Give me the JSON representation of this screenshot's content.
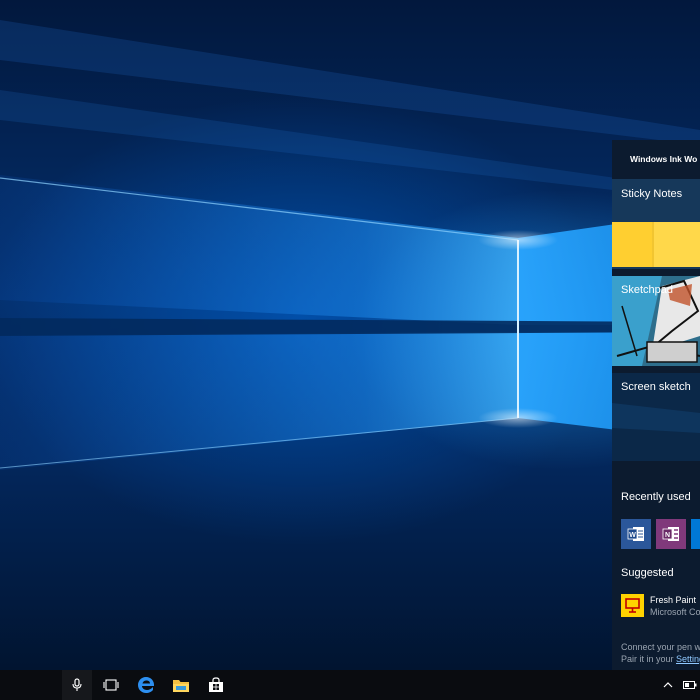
{
  "ink_workspace": {
    "title": "Windows Ink Wo",
    "sections": {
      "sticky_notes": "Sticky Notes",
      "sketchpad": "Sketchpad",
      "screen_sketch": "Screen sketch",
      "recently_used": "Recently used",
      "suggested": "Suggested"
    },
    "recent_apps": [
      {
        "name": "Word",
        "icon": "word-icon",
        "color": "#2b579a"
      },
      {
        "name": "OneNote",
        "icon": "onenote-icon",
        "color": "#80397b"
      },
      {
        "name": "App",
        "icon": "app-icon",
        "color": "#0078d7"
      }
    ],
    "suggested_app": {
      "name": "Fresh Paint",
      "publisher": "Microsoft Co",
      "icon": "fresh-paint-icon",
      "color": "#ffd200"
    },
    "footer": {
      "line1": "Connect your pen wi",
      "line2_prefix": "Pair it in your ",
      "line2_link": "Setting"
    }
  },
  "taskbar": {
    "icons": [
      "microphone-icon",
      "task-view-icon",
      "edge-icon",
      "file-explorer-icon",
      "store-icon",
      "chevron-up-icon",
      "battery-icon"
    ]
  },
  "colors": {
    "accent": "#0078d7",
    "panel_bg": "#0c1b2f",
    "sticky_yellow": "#ffd23f",
    "taskbar_bg": "#0a0c10"
  }
}
